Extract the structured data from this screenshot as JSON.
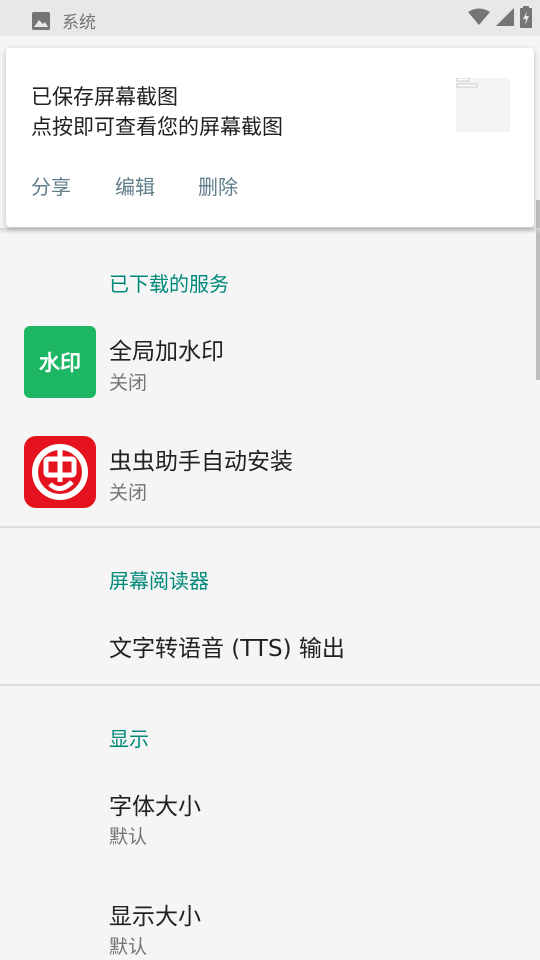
{
  "status_bar": {
    "title": "系统",
    "icons": [
      "image-icon",
      "wifi-icon",
      "signal-icon",
      "battery-charging-icon"
    ]
  },
  "notification": {
    "title": "已保存屏幕截图",
    "text": "点按即可查看您的屏幕截图",
    "actions": [
      "分享",
      "编辑",
      "删除"
    ]
  },
  "sections": {
    "downloaded": {
      "header": "已下载的服务",
      "items": [
        {
          "title": "全局加水印",
          "subtitle": "关闭",
          "icon_label": "水印"
        },
        {
          "title": "虫虫助手自动安装",
          "subtitle": "关闭"
        }
      ]
    },
    "screen_reader": {
      "header": "屏幕阅读器",
      "items": [
        {
          "title": "文字转语音 (TTS) 输出"
        }
      ]
    },
    "display": {
      "header": "显示",
      "items": [
        {
          "title": "字体大小",
          "subtitle": "默认"
        },
        {
          "title": "显示大小",
          "subtitle": "默认"
        }
      ]
    }
  },
  "colors": {
    "accent": "#00897b",
    "watermark_icon": "#1db664",
    "chongchong_icon": "#e4131d",
    "action_text": "#607d8b"
  }
}
